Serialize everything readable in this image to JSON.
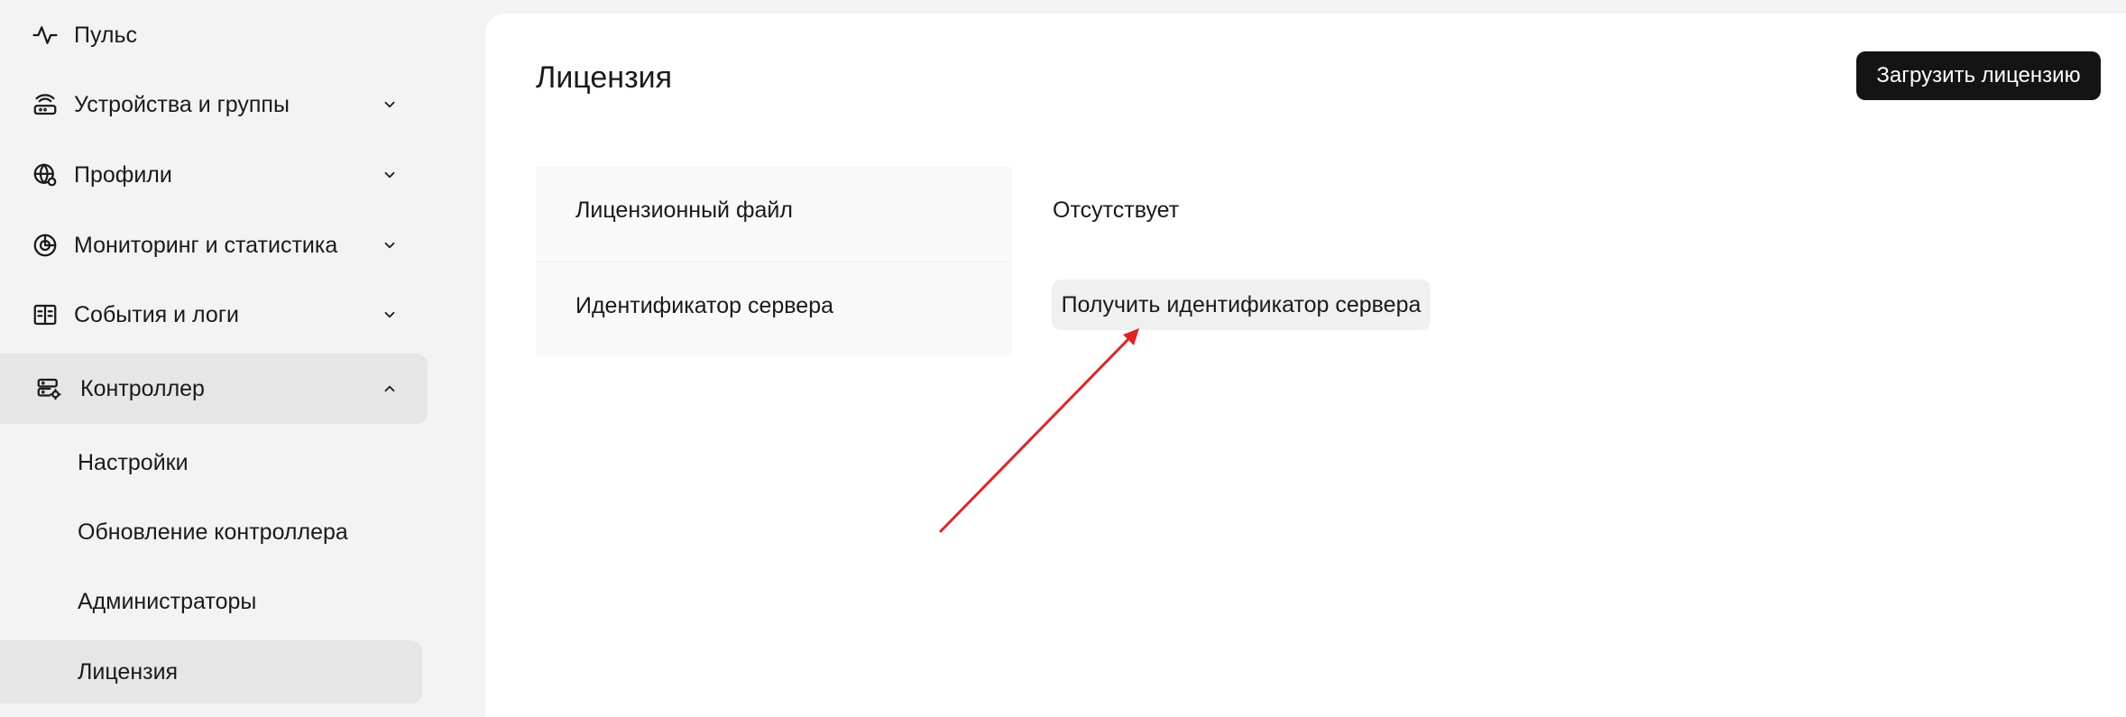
{
  "sidebar": {
    "items": [
      {
        "label": "Пульс",
        "icon": "pulse-icon"
      },
      {
        "label": "Устройства и группы",
        "icon": "router-icon",
        "expandable": true
      },
      {
        "label": "Профили",
        "icon": "globe-settings-icon",
        "expandable": true
      },
      {
        "label": "Мониторинг и статистика",
        "icon": "pie-chart-icon",
        "expandable": true
      },
      {
        "label": "События и логи",
        "icon": "book-icon",
        "expandable": true
      },
      {
        "label": "Контроллер",
        "icon": "server-settings-icon",
        "expanded": true
      }
    ],
    "subitems": [
      {
        "label": "Настройки"
      },
      {
        "label": "Обновление контроллера"
      },
      {
        "label": "Администраторы"
      },
      {
        "label": "Лицензия",
        "active": true
      }
    ]
  },
  "main": {
    "title": "Лицензия",
    "upload_button": "Загрузить лицензию",
    "rows": [
      {
        "label": "Лицензионный файл",
        "value": "Отсутствует"
      },
      {
        "label": "Идентификатор сервера",
        "button": "Получить идентификатор сервера"
      }
    ]
  },
  "annotation": {
    "type": "arrow",
    "color": "#e02424"
  }
}
